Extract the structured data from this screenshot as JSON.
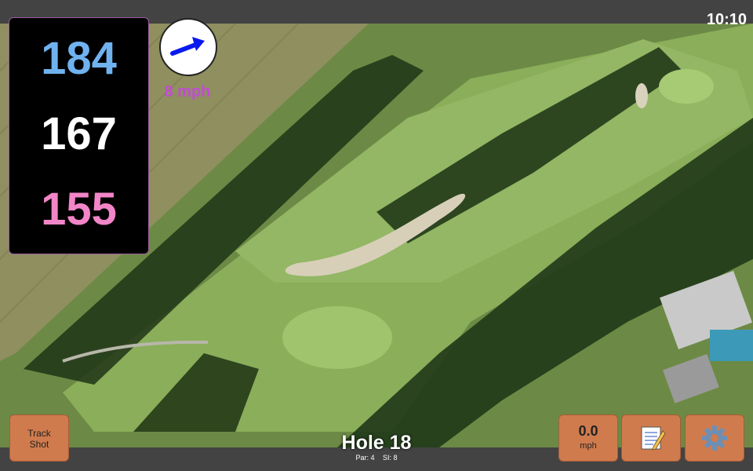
{
  "status": {
    "time": "10:10"
  },
  "distances": {
    "back": "184",
    "middle": "167",
    "front": "155"
  },
  "wind": {
    "speed_label": "8 mph",
    "icon": "wind-direction-arrow-icon"
  },
  "hole": {
    "title": "Hole 18",
    "par": "Par: 4",
    "si": "SI: 8"
  },
  "buttons": {
    "track_shot_line1": "Track",
    "track_shot_line2": "Shot",
    "speed_value": "0.0",
    "speed_unit": "mph",
    "notes_icon": "notepad-icon",
    "settings_icon": "gear-icon"
  },
  "colors": {
    "back": "#6fb2ef",
    "middle": "#ffffff",
    "front": "#f285c8",
    "wind_text": "#c34bd6",
    "button": "#d07b4d"
  }
}
